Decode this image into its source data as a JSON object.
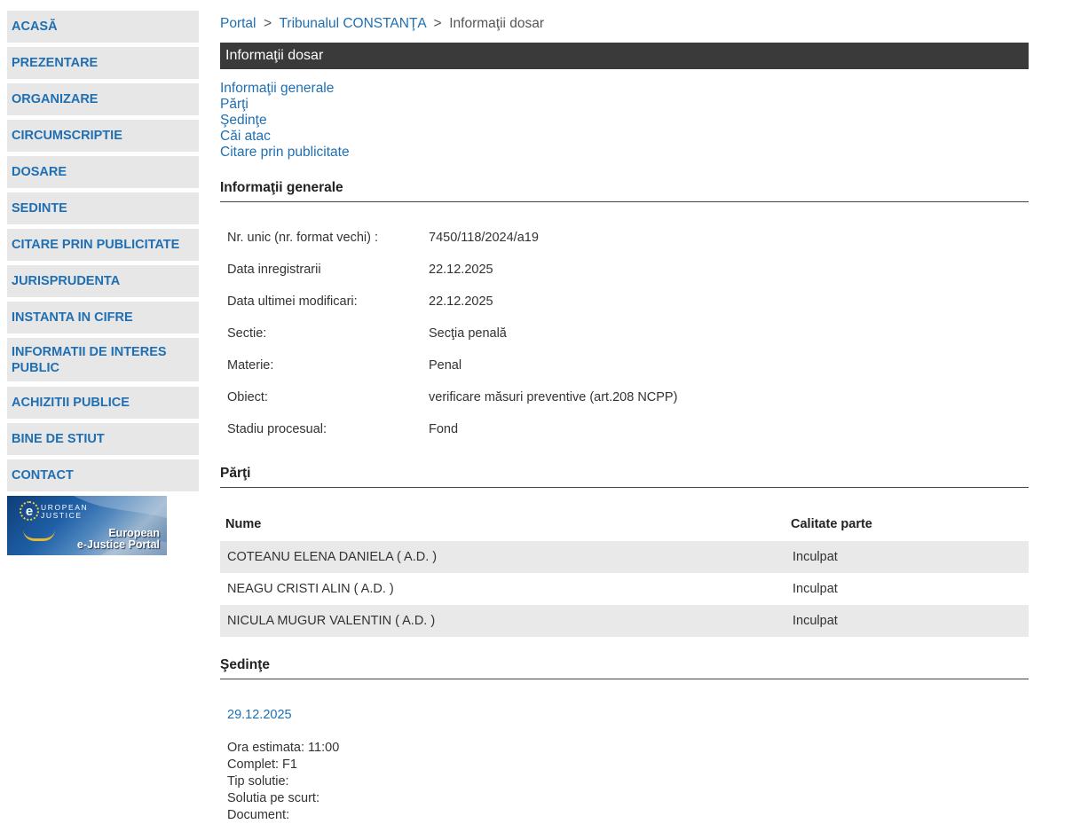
{
  "sidebar": {
    "items": [
      {
        "label": "ACASĂ"
      },
      {
        "label": "PREZENTARE"
      },
      {
        "label": "ORGANIZARE"
      },
      {
        "label": "CIRCUMSCRIPTIE"
      },
      {
        "label": "DOSARE"
      },
      {
        "label": "SEDINTE"
      },
      {
        "label": "CITARE PRIN PUBLICITATE"
      },
      {
        "label": "JURISPRUDENTA"
      },
      {
        "label": "INSTANTA IN CIFRE"
      },
      {
        "label": "INFORMATII DE INTERES PUBLIC"
      },
      {
        "label": "ACHIZITII PUBLICE"
      },
      {
        "label": "BINE DE STIUT"
      },
      {
        "label": "CONTACT"
      }
    ],
    "banner": {
      "logo_letter": "e",
      "logo_text_line1": "UROPEAN",
      "logo_text_line2": "JUSTICE",
      "title_line1": "European",
      "title_line2": "e-Justice Portal"
    }
  },
  "breadcrumb": {
    "portal": "Portal",
    "court": "Tribunalul CONSTANŢA",
    "current": "Informaţii dosar",
    "separator": ">"
  },
  "title_bar": "Informaţii dosar",
  "section_links": [
    "Informaţii generale",
    "Părţi",
    "Şedinţe",
    "Căi atac",
    "Citare prin publicitate"
  ],
  "general": {
    "heading": "Informaţii generale",
    "rows": [
      {
        "label": "Nr. unic (nr. format vechi) :",
        "value": "7450/118/2024/a19"
      },
      {
        "label": "Data inregistrarii",
        "value": "22.12.2025"
      },
      {
        "label": "Data ultimei modificari:",
        "value": "22.12.2025"
      },
      {
        "label": "Sectie:",
        "value": "Secţia penală"
      },
      {
        "label": "Materie:",
        "value": "Penal"
      },
      {
        "label": "Obiect:",
        "value": "verificare măsuri preventive (art.208 NCPP)"
      },
      {
        "label": "Stadiu procesual:",
        "value": "Fond"
      }
    ]
  },
  "parti": {
    "heading": "Părţi",
    "col_name": "Nume",
    "col_role": "Calitate parte",
    "rows": [
      {
        "name": "COTEANU ELENA DANIELA ( A.D. )",
        "role": "Inculpat"
      },
      {
        "name": "NEAGU CRISTI ALIN ( A.D. )",
        "role": "Inculpat"
      },
      {
        "name": "NICULA MUGUR VALENTIN ( A.D. )",
        "role": "Inculpat"
      }
    ]
  },
  "sedinte": {
    "heading": "Şedinţe",
    "date": "29.12.2025",
    "lines": [
      "Ora estimata: 11:00",
      "Complet: F1",
      "Tip solutie:",
      "Solutia pe scurt:",
      "Document:"
    ]
  }
}
